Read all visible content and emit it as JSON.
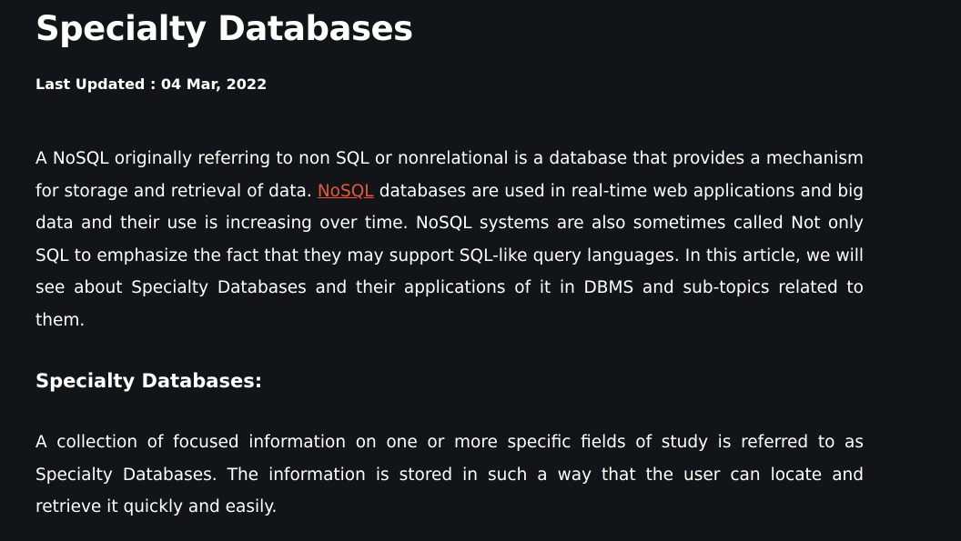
{
  "article": {
    "title": "Specialty Databases",
    "last_updated": "Last Updated : 04 Mar, 2022",
    "intro": {
      "before_link": "A NoSQL originally referring to non SQL or nonrelational is a database that provides a mechanism for storage and retrieval of data. ",
      "link_text": "NoSQL",
      "after_link": " databases are used in real-time web applications and big data and their use is increasing over time. NoSQL systems are also sometimes called Not only SQL to emphasize the fact that they may support SQL-like query languages. In this article, we will see about Specialty Databases and their applications of it in DBMS and sub-topics related to them."
    },
    "section_heading": "Specialty Databases:",
    "section_paragraph": "A collection of focused information on one or more specific fields of study is referred to as Specialty Databases. The information is stored in such a way that the user can locate and retrieve it quickly and easily."
  },
  "colors": {
    "background": "#131417",
    "text": "#ffffff",
    "link": "#e8583f"
  }
}
